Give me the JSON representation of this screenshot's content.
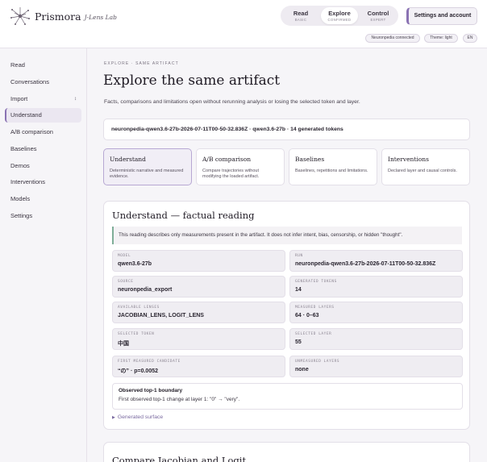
{
  "brand": {
    "name": "Prismora",
    "subtitle": "J-Lens Lab",
    "logo_icon": "neuron-spark-icon"
  },
  "modes": [
    {
      "label": "Read",
      "sub": "BASIC"
    },
    {
      "label": "Explore",
      "sub": "CONFIRMED",
      "active": true
    },
    {
      "label": "Control",
      "sub": "EXPERT"
    }
  ],
  "settings_button": "Settings and account",
  "status_pills": {
    "connection": "Neuronpedia connected",
    "theme": "Theme: light",
    "language": "EN"
  },
  "sidebar": {
    "items": [
      {
        "label": "Read"
      },
      {
        "label": "Conversations"
      },
      {
        "label": "Import",
        "caret": "↕"
      },
      {
        "label": "Understand",
        "active": true
      },
      {
        "label": "A/B comparison"
      },
      {
        "label": "Baselines"
      },
      {
        "label": "Demos"
      },
      {
        "label": "Interventions"
      },
      {
        "label": "Models"
      },
      {
        "label": "Settings"
      }
    ]
  },
  "main": {
    "eyebrow": "EXPLORE · SAME ARTIFACT",
    "title": "Explore the same artifact",
    "description": "Facts, comparisons and limitations open without rerunning analysis or losing the selected token and layer.",
    "artifact": "neuronpedia-qwen3.6-27b-2026-07-11T00-50-32.836Z · qwen3.6-27b · 14 generated tokens",
    "cards": [
      {
        "title": "Understand",
        "desc": "Deterministic narrative and measured evidence.",
        "active": true
      },
      {
        "title": "A/B comparison",
        "desc": "Compare trajectories without modifying the loaded artifact."
      },
      {
        "title": "Baselines",
        "desc": "Baselines, repetitions and limitations."
      },
      {
        "title": "Interventions",
        "desc": "Declared layer and causal controls."
      }
    ],
    "panel": {
      "title": "Understand — factual reading",
      "note": "This reading describes only measurements present in the artifact. It does not infer intent, bias, censorship, or hidden \"thought\".",
      "fields": [
        {
          "label": "MODEL",
          "value": "qwen3.6-27b"
        },
        {
          "label": "RUN",
          "value": "neuronpedia-qwen3.6-27b-2026-07-11T00-50-32.836Z"
        },
        {
          "label": "SOURCE",
          "value": "neuronpedia_export"
        },
        {
          "label": "GENERATED TOKENS",
          "value": "14"
        },
        {
          "label": "AVAILABLE LENSES",
          "value": "JACOBIAN_LENS, LOGIT_LENS"
        },
        {
          "label": "MEASURED LAYERS",
          "value": "64 · 0–63"
        },
        {
          "label": "SELECTED TOKEN",
          "value": "中国"
        },
        {
          "label": "SELECTED LAYER",
          "value": "55"
        },
        {
          "label": "FIRST MEASURED CANDIDATE",
          "value": "“の” · p=0.0052"
        },
        {
          "label": "UNMEASURED LAYERS",
          "value": "none"
        }
      ],
      "boundary_title": "Observed top-1 boundary",
      "boundary_text": "First observed top-1 change at layer 1: \"0\" → \"very\".",
      "summary": "Generated surface"
    },
    "panel2": {
      "title": "Compare Jacobian and Logit"
    }
  },
  "colors": {
    "accent": "#8a72b3",
    "note_border": "#7fae98",
    "panel_bg": "#ffffff",
    "page_bg": "#f6f5f8"
  }
}
